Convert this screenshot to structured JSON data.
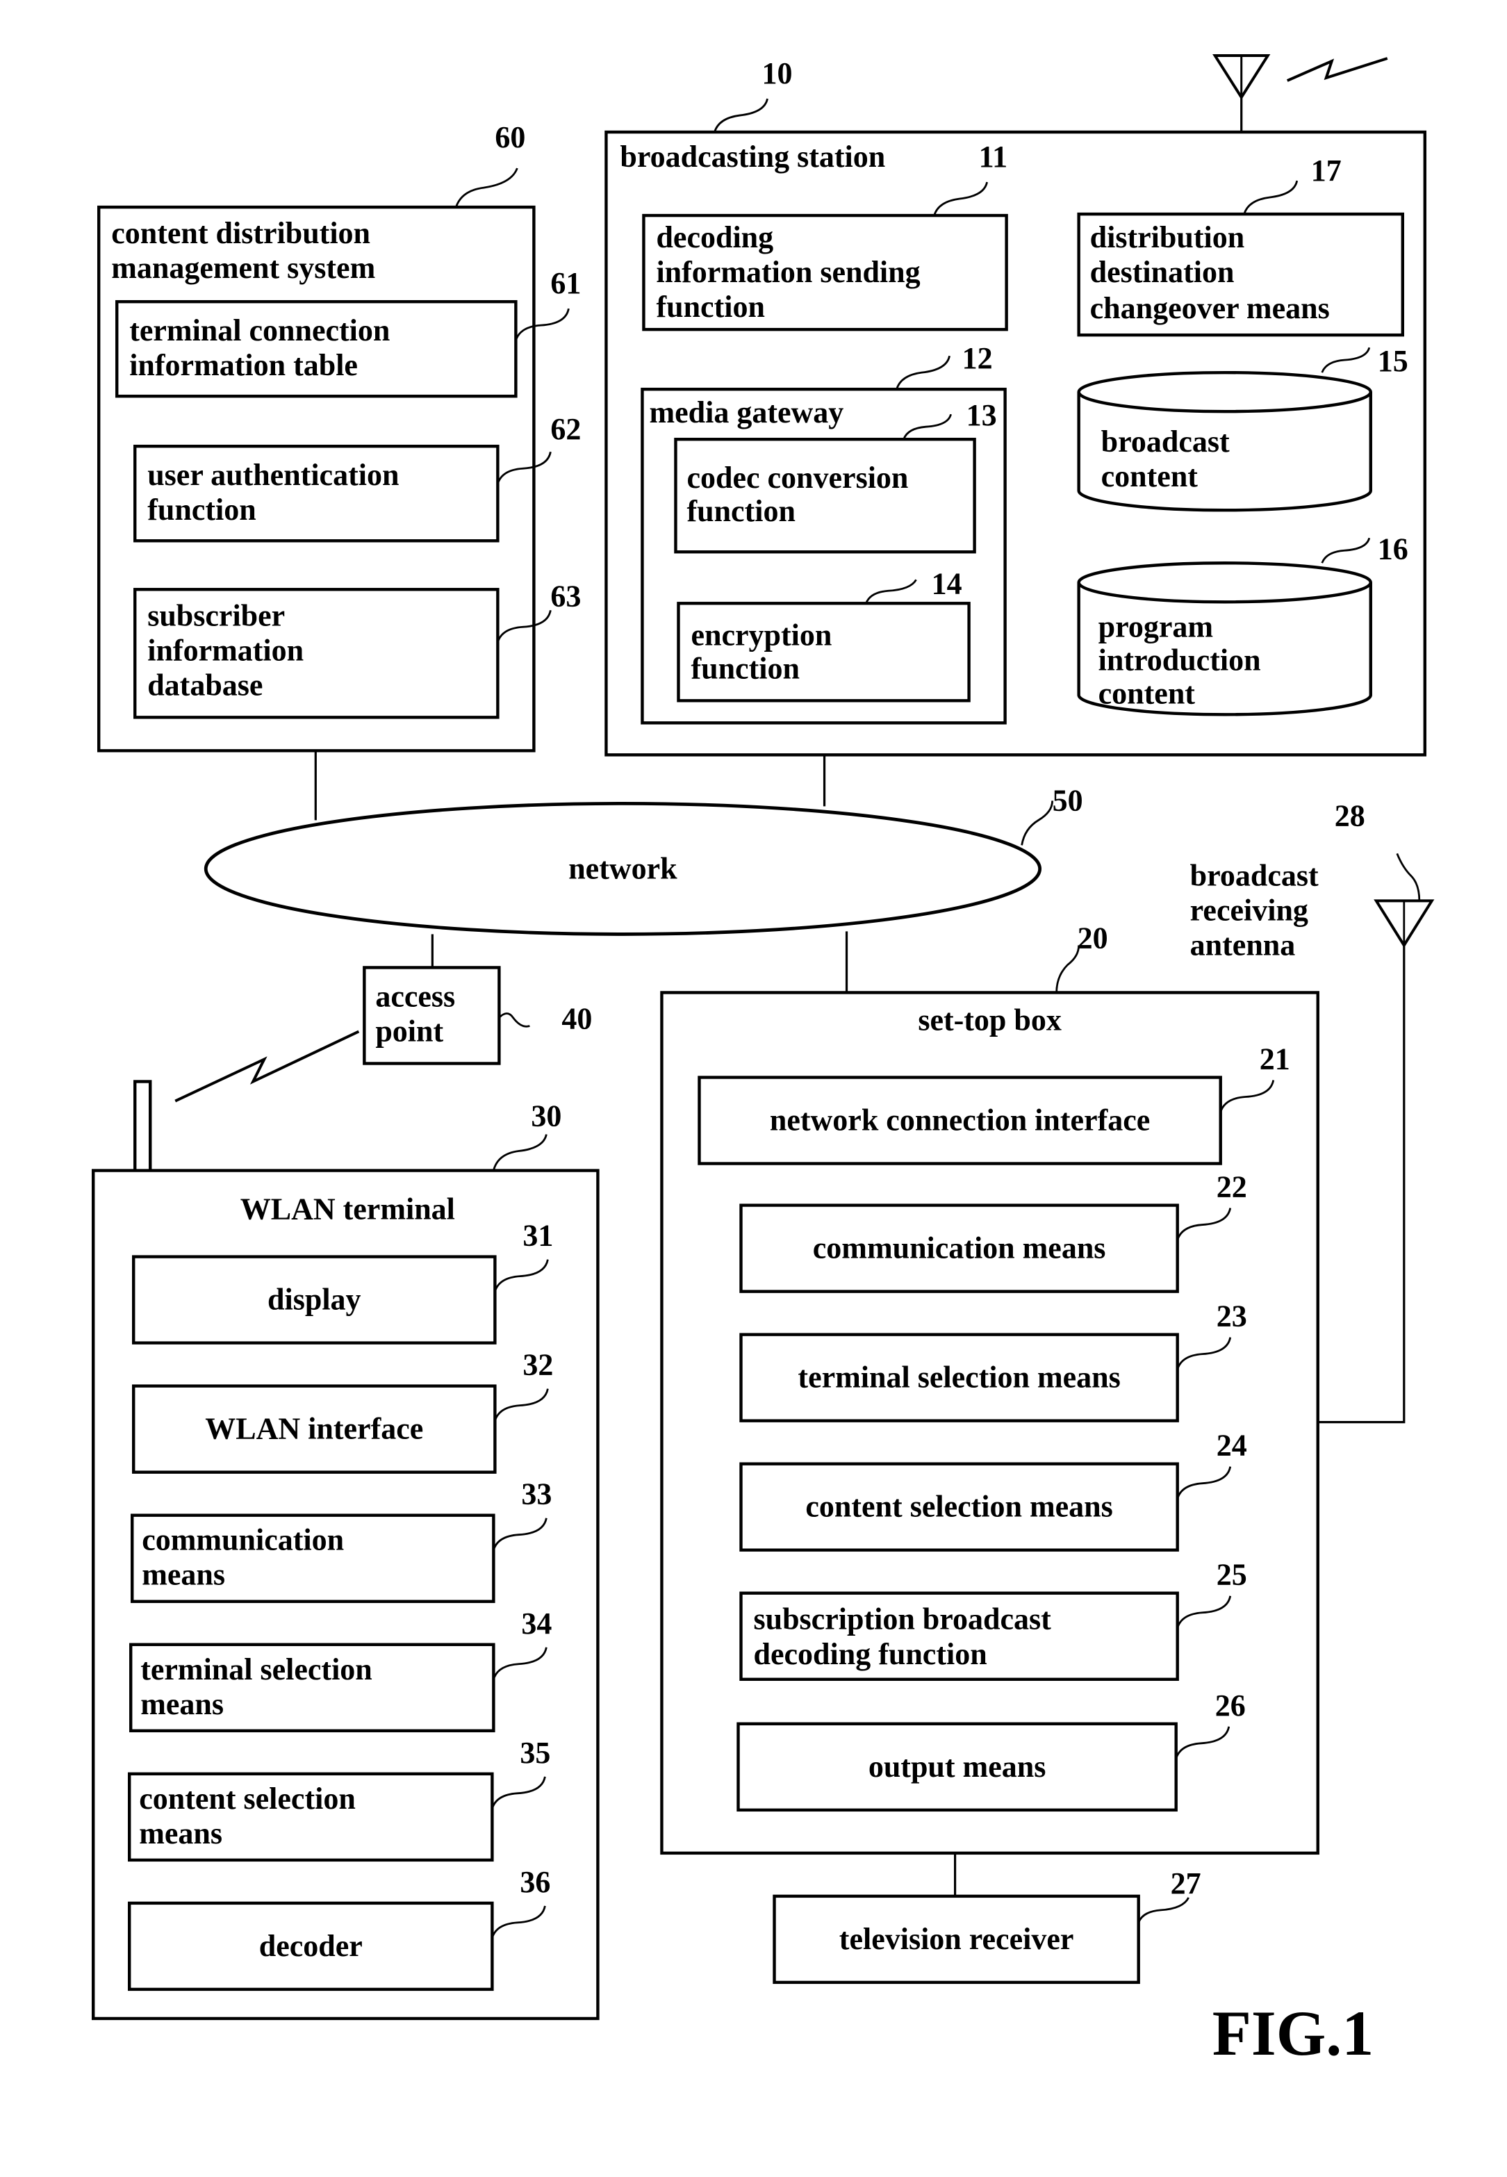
{
  "figure_label": "FIG.1",
  "nodes": {
    "cdms": {
      "ref": "60",
      "title": [
        "content distribution",
        "management system"
      ],
      "items": [
        {
          "ref": "61",
          "lines": [
            "terminal connection",
            "information table"
          ]
        },
        {
          "ref": "62",
          "lines": [
            "user authentication",
            "function"
          ]
        },
        {
          "ref": "63",
          "lines": [
            "subscriber",
            "information",
            "database"
          ]
        }
      ]
    },
    "station": {
      "ref": "10",
      "title": "broadcasting station",
      "decoding": {
        "ref": "11",
        "lines": [
          "decoding",
          "information sending",
          "function"
        ]
      },
      "gateway": {
        "ref": "12",
        "title": "media gateway"
      },
      "codec": {
        "ref": "13",
        "lines": [
          "codec conversion",
          "function"
        ]
      },
      "encryption": {
        "ref": "14",
        "lines": [
          "encryption",
          "function"
        ]
      },
      "broadcast_content": {
        "ref": "15",
        "lines": [
          "broadcast",
          "content"
        ]
      },
      "program_content": {
        "ref": "16",
        "lines": [
          "program",
          "introduction",
          "content"
        ]
      },
      "changeover": {
        "ref": "17",
        "lines": [
          "distribution",
          "destination",
          "changeover means"
        ]
      }
    },
    "network": {
      "ref": "50",
      "label": "network"
    },
    "access_point": {
      "ref": "40",
      "lines": [
        "access",
        "point"
      ]
    },
    "antenna": {
      "ref": "28",
      "lines": [
        "broadcast",
        "receiving",
        "antenna"
      ]
    },
    "stb": {
      "ref": "20",
      "title": "set-top box",
      "items": [
        {
          "ref": "21",
          "lines": [
            "network connection interface"
          ]
        },
        {
          "ref": "22",
          "lines": [
            "communication means"
          ]
        },
        {
          "ref": "23",
          "lines": [
            "terminal selection means"
          ]
        },
        {
          "ref": "24",
          "lines": [
            "content selection means"
          ]
        },
        {
          "ref": "25",
          "lines": [
            "subscription broadcast",
            "decoding function"
          ]
        },
        {
          "ref": "26",
          "lines": [
            "output means"
          ]
        }
      ]
    },
    "tv": {
      "ref": "27",
      "label": "television receiver"
    },
    "wlan": {
      "ref": "30",
      "title": "WLAN terminal",
      "items": [
        {
          "ref": "31",
          "lines": [
            "display"
          ]
        },
        {
          "ref": "32",
          "lines": [
            "WLAN interface"
          ]
        },
        {
          "ref": "33",
          "lines": [
            "communication",
            "means"
          ]
        },
        {
          "ref": "34",
          "lines": [
            "terminal selection",
            "means"
          ]
        },
        {
          "ref": "35",
          "lines": [
            "content selection",
            "means"
          ]
        },
        {
          "ref": "36",
          "lines": [
            "decoder"
          ]
        }
      ]
    }
  }
}
